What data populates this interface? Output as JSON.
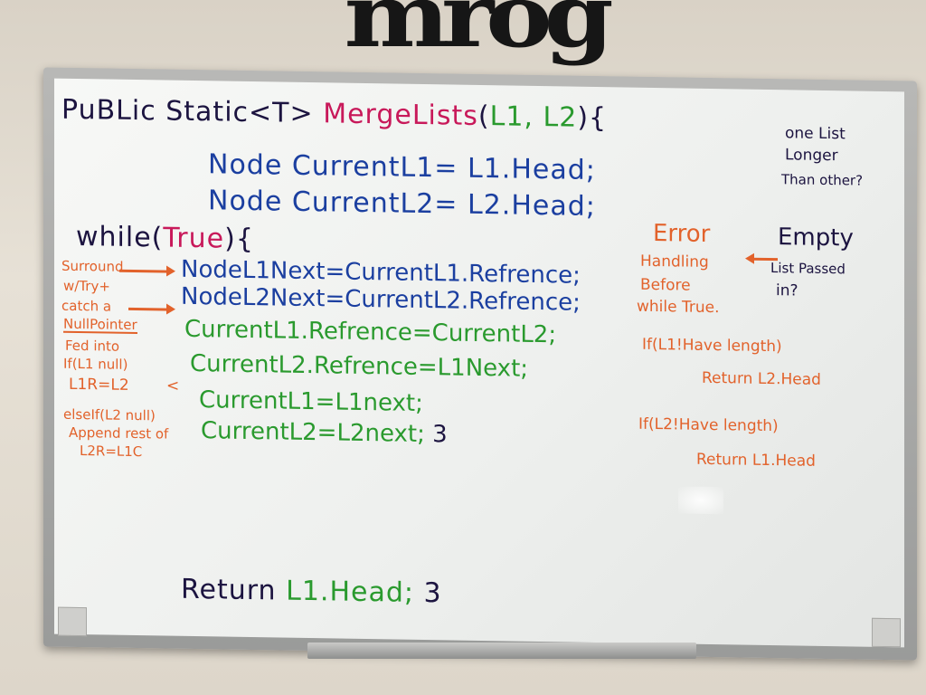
{
  "wall": {
    "letters": "mrog"
  },
  "board": {
    "signature": {
      "public_static": "PuBLic Static",
      "generic": "<T>",
      "method": "MergeLists",
      "open_paren": "(",
      "params": "L1, L2",
      "close": "){"
    },
    "code": {
      "node_current_l1": "Node CurrentL1= L1.Head;",
      "node_current_l2": "Node CurrentL2= L2.Head;",
      "while_kw": "while(",
      "while_true": "True",
      "while_close": "){",
      "l1_next": "NodeL1Next=CurrentL1.Refrence;",
      "l2_next": "NodeL2Next=CurrentL2.Refrence;",
      "l1_ref": "CurrentL1.Refrence=CurrentL2;",
      "l2_ref": "CurrentL2.Refrence=L1Next;",
      "cur_l1": "CurrentL1=L1next;",
      "cur_l2": "CurrentL2=L2next;",
      "loop_close": "3",
      "return_kw": "Return",
      "return_val": "L1.Head;",
      "method_close": "3"
    },
    "left_notes": {
      "surround": "Surround",
      "try": "w/Try+",
      "catch": "catch a",
      "nullpointer": "NullPointer",
      "fedinto": "Fed into",
      "if_l1": "If(L1 null)",
      "l1_eq": "L1R=L2",
      "elseif": "elseIf(L2 null)",
      "append": "Append rest of",
      "l2_eq": "L2R=L1C"
    },
    "right_notes": {
      "q1_line1": "one List",
      "q1_line2": "Longer",
      "q1_line3": "Than other?",
      "q2_line1": "Empty",
      "q2_line2": "List Passed",
      "q2_line3": "in?",
      "err1": "Error",
      "err2": "Handling",
      "err3": "Before",
      "err4": "while True.",
      "if1": "If(L1!Have length)",
      "ret1": "Return L2.Head",
      "if2": "If(L2!Have length)",
      "ret2": "Return L1.Head"
    }
  }
}
